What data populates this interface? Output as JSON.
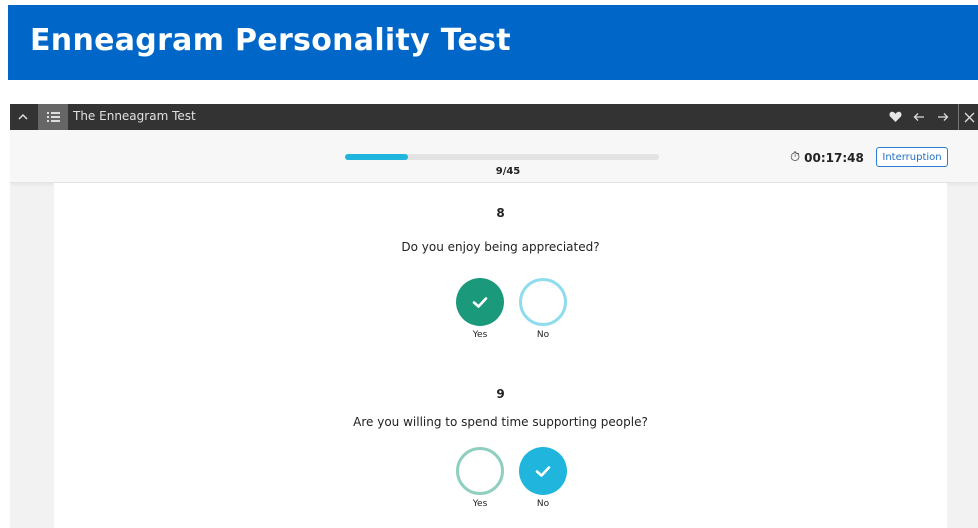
{
  "page": {
    "banner_title": "Enneagram Personality Test"
  },
  "topbar": {
    "title": "The Enneagram Test"
  },
  "progress": {
    "current": 9,
    "total": 45,
    "label": "9/45"
  },
  "timer": {
    "value": "00:17:48"
  },
  "interrupt_button": {
    "label": "Interruption"
  },
  "questions": [
    {
      "number": "8",
      "text": "Do you enjoy being appreciated?",
      "yes_label": "Yes",
      "no_label": "No",
      "selected": "Yes"
    },
    {
      "number": "9",
      "text": "Are you willing to spend time supporting people?",
      "yes_label": "Yes",
      "no_label": "No",
      "selected": "No"
    }
  ],
  "colors": {
    "banner": "#0067c8",
    "yes_selected": "#1a9a7a",
    "yes_outline": "#8fcfc0",
    "no_selected": "#1fb5dc",
    "no_outline": "#8fdcef",
    "progress": "#1fb5dc"
  },
  "icons": {
    "topbar": [
      "chevron-up-icon",
      "list-icon",
      "heart-icon",
      "arrow-left-icon",
      "arrow-right-icon",
      "close-icon"
    ],
    "timer": "stopwatch-icon",
    "option": "checkmark-icon"
  }
}
